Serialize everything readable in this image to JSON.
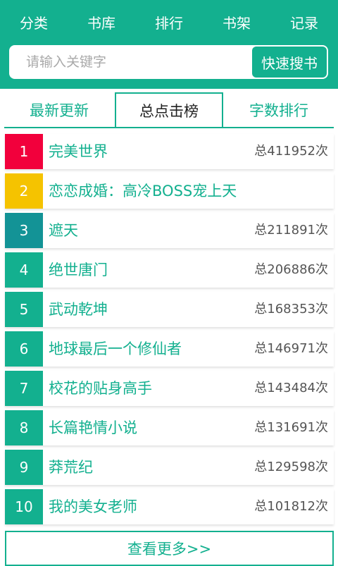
{
  "nav": {
    "items": [
      "分类",
      "书库",
      "排行",
      "书架",
      "记录"
    ]
  },
  "search": {
    "placeholder": "请输入关键字",
    "button_label": "快速搜书"
  },
  "tabs": {
    "items": [
      "最新更新",
      "总点击榜",
      "字数排行"
    ],
    "active_index": 1
  },
  "ranking": [
    {
      "rank": "1",
      "title": "完美世界",
      "count": "总411952次",
      "color": "#f2003c"
    },
    {
      "rank": "2",
      "title": "恋恋成婚：高冷BOSS宠上天",
      "count": "",
      "color": "#f5c300"
    },
    {
      "rank": "3",
      "title": "遮天",
      "count": "总211891次",
      "color": "#139396"
    },
    {
      "rank": "4",
      "title": "绝世唐门",
      "count": "总206886次",
      "color": "#13b08f"
    },
    {
      "rank": "5",
      "title": "武动乾坤",
      "count": "总168353次",
      "color": "#13b08f"
    },
    {
      "rank": "6",
      "title": "地球最后一个修仙者",
      "count": "总146971次",
      "color": "#13b08f"
    },
    {
      "rank": "7",
      "title": "校花的贴身高手",
      "count": "总143484次",
      "color": "#13b08f"
    },
    {
      "rank": "8",
      "title": "长篇艳情小说",
      "count": "总131691次",
      "color": "#13b08f"
    },
    {
      "rank": "9",
      "title": "莽荒纪",
      "count": "总129598次",
      "color": "#13b08f"
    },
    {
      "rank": "10",
      "title": "我的美女老师",
      "count": "总101812次",
      "color": "#13b08f"
    }
  ],
  "more": {
    "label": "查看更多>>"
  }
}
